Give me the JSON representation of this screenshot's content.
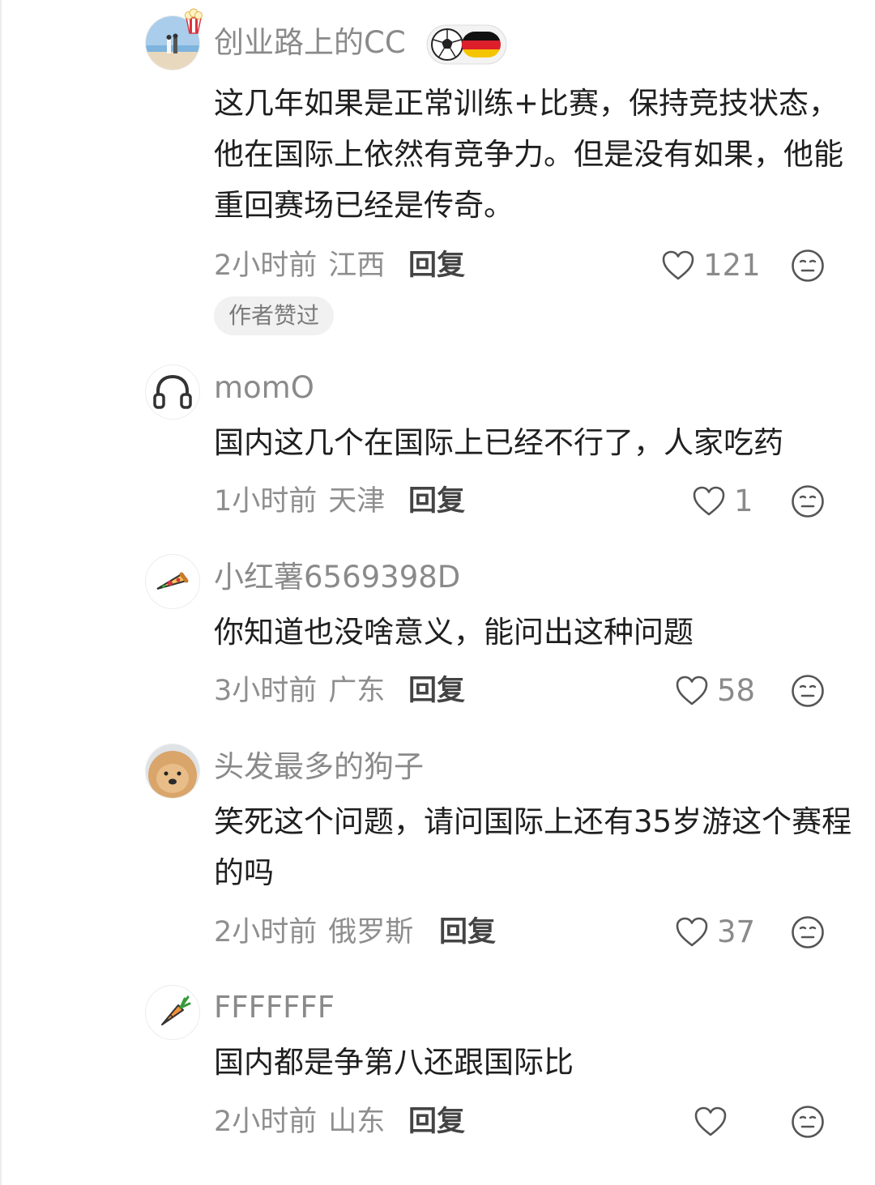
{
  "comments": [
    {
      "username": "创业路上的CC",
      "text": "这几年如果是正常训练+比赛，保持竞技状态，他在国际上依然有竞争力。但是没有如果，他能重回赛场已经是传奇。",
      "time": "2小时前",
      "location": "江西",
      "reply": "回复",
      "likes": "121",
      "author_liked": "作者赞过",
      "avatar_icon": "beach-couple-photo",
      "badge_icon": "football-germany-flag-badge"
    },
    {
      "username": "momO",
      "text": "国内这几个在国际上已经不行了，人家吃药",
      "time": "1小时前",
      "location": "天津",
      "reply": "回复",
      "likes": "1",
      "avatar_icon": "headphones-icon"
    },
    {
      "username": "小红薯6569398D",
      "text": "你知道也没啥意义，能问出这种问题",
      "time": "3小时前",
      "location": "广东",
      "reply": "回复",
      "likes": "58",
      "avatar_icon": "pizza-icon"
    },
    {
      "username": "头发最多的狗子",
      "text": "笑死这个问题，请问国际上还有35岁游这个赛程的吗",
      "time": "2小时前",
      "location": "俄罗斯",
      "reply": "回复",
      "likes": "37",
      "avatar_icon": "fluffy-dog-photo"
    },
    {
      "username": "FFFFFFF",
      "text": "国内都是争第八还跟国际比",
      "time": "2小时前",
      "location": "山东",
      "reply": "回复",
      "likes": "",
      "avatar_icon": "carrot-icon"
    }
  ],
  "colors": {
    "background": "#ffffff",
    "username": "#8a8a8a",
    "body_text": "#1f1f1f",
    "meta": "#8e8e8e",
    "tag_bg": "#f1f1f1"
  }
}
